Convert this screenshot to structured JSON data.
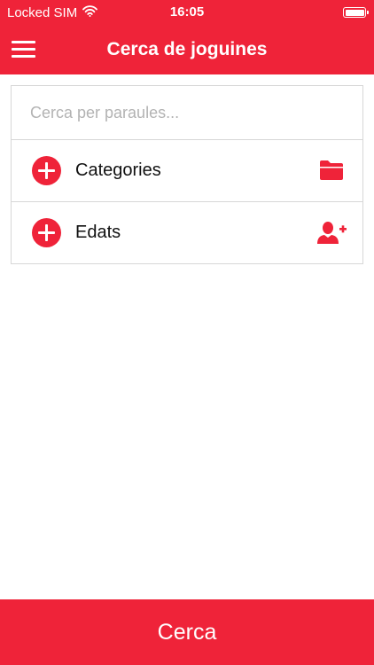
{
  "status_bar": {
    "carrier": "Locked SIM",
    "time": "16:05",
    "icons": [
      "wifi-icon",
      "battery-icon"
    ]
  },
  "header": {
    "title": "Cerca de joguines",
    "menu_icon": "hamburger-menu-icon"
  },
  "search": {
    "value": "",
    "placeholder": "Cerca per paraules..."
  },
  "filters": [
    {
      "label": "Categories",
      "icon": "folder-icon"
    },
    {
      "label": "Edats",
      "icon": "add-user-icon"
    }
  ],
  "footer": {
    "search_label": "Cerca"
  },
  "colors": {
    "accent": "#ef2339",
    "divider": "#d7d7d7",
    "placeholder": "#b3b3b3"
  }
}
